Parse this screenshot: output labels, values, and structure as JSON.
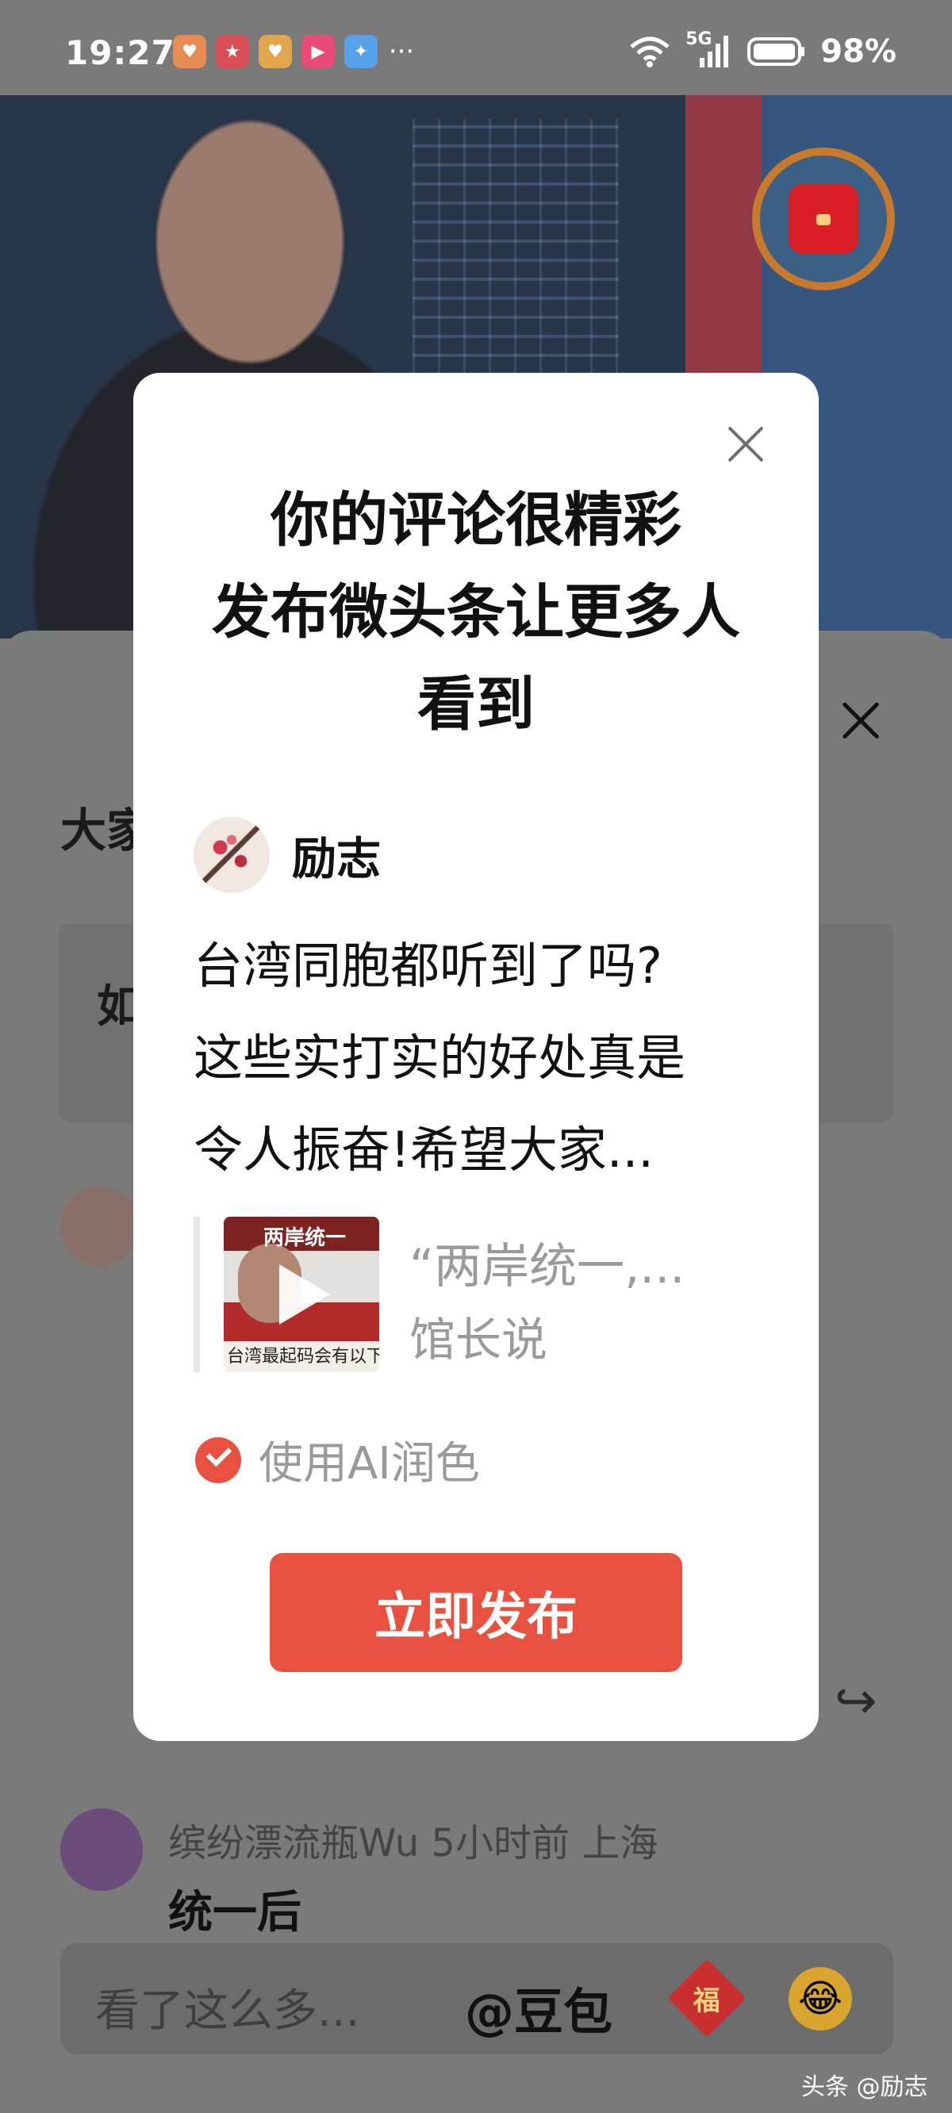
{
  "status_bar": {
    "time": "19:27",
    "notification_icons": [
      "heart-app-icon",
      "618-app-icon",
      "heart-app-icon",
      "video-app-icon",
      "pinwheel-app-icon"
    ],
    "more": "···",
    "network": "5G",
    "battery": "98%"
  },
  "background": {
    "section_title_partial": "大家",
    "card_text_partial": "如",
    "comment": {
      "username_meta": "缤纷漂流瓶Wu  5小时前  上海",
      "text_partial": "统一后"
    },
    "input_placeholder": "看了这么多...",
    "mention": "@豆包",
    "fu_char": "福",
    "watermark": "头条 @励志"
  },
  "modal": {
    "title_lines": [
      "你的评论很精彩",
      "发布微头条让更多人",
      "看到"
    ],
    "author_name": "励志",
    "post_lines": [
      "台湾同胞都听到了吗?",
      "这些实打实的好处真是",
      "令人振奋!希望大家..."
    ],
    "quote": {
      "title": "“两岸统一,...",
      "source": "馆长说",
      "thumb_tag": "两岸统一",
      "thumb_caption": "台湾最起码会有以下这"
    },
    "ai_option_label": "使用AI润色",
    "ai_option_checked": true,
    "publish_label": "立即发布"
  },
  "colors": {
    "accent": "#e8503f",
    "overlay": "#7a7a7a",
    "muted_text": "#9a9a9a"
  }
}
